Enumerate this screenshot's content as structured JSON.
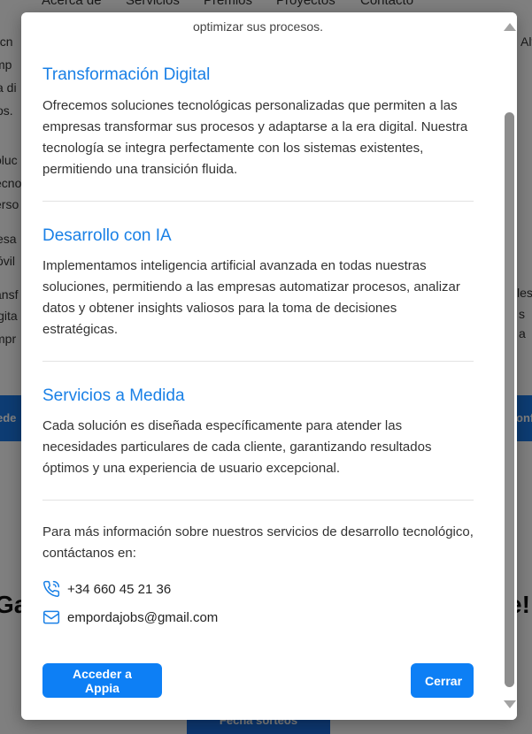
{
  "background": {
    "nav": [
      "Acerca de",
      "Servicios",
      "Premios",
      "Proyectos",
      "Contacto"
    ],
    "left_fragments": [
      "ecn",
      "mp",
      "a di",
      "os.",
      "oluc",
      "ecno",
      "erso",
      "esa",
      "óvil",
      "ansf",
      "igita",
      "mpr"
    ],
    "right_fragments": [
      "Alt",
      "les",
      "s a"
    ],
    "band_left": "ede",
    "band_right": "onf",
    "heading_left": "Ga",
    "heading_right": "e!",
    "bottom_button": "Fecha sorteos"
  },
  "modal": {
    "intro_tail": "optimizar sus procesos.",
    "sections": [
      {
        "title": "Transformación Digital",
        "body": "Ofrecemos soluciones tecnológicas personalizadas que permiten a las empresas transformar sus procesos y adaptarse a la era digital. Nuestra tecnología se integra perfectamente con los sistemas existentes, permitiendo una transición fluida."
      },
      {
        "title": "Desarrollo con IA",
        "body": "Implementamos inteligencia artificial avanzada en todas nuestras soluciones, permitiendo a las empresas automatizar procesos, analizar datos y obtener insights valiosos para la toma de decisiones estratégicas."
      },
      {
        "title": "Servicios a Medida",
        "body": "Cada solución es diseñada específicamente para atender las necesidades particulares de cada cliente, garantizando resultados óptimos y una experiencia de usuario excepcional."
      }
    ],
    "contact": {
      "intro": "Para más información sobre nuestros servicios de desarrollo tecnológico, contáctanos en:",
      "phone": "+34 660 45 21 36",
      "email": "empordajobs@gmail.com",
      "phone_icon": "phone-icon",
      "email_icon": "mail-icon"
    },
    "buttons": {
      "primary": "Acceder a Appia",
      "close": "Cerrar"
    }
  },
  "colors": {
    "accent": "#0d7ff5",
    "section_title": "#1a80e6",
    "overlay": "rgba(0,0,0,0.5)"
  }
}
